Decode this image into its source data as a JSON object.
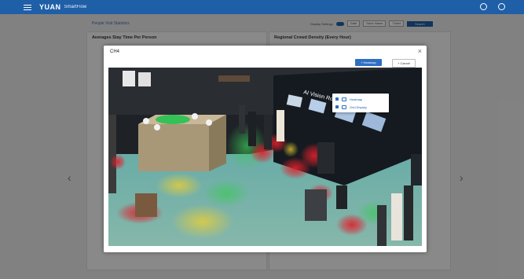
{
  "topbar": {
    "brand": "YUAN",
    "product": "SmartFlow"
  },
  "background_page": {
    "title": "People Visit Statistics",
    "filters": [
      "Display Settings",
      "Date",
      "Store Name",
      "Ticket",
      "Search"
    ],
    "panel_left_title": "Averages Stay Time Per Person",
    "panel_right_title": "Regional Crowd Density (Every Hour)"
  },
  "modal": {
    "title": "CH4",
    "heatmap_button": "+ Heatmap",
    "cancel_button": "+ Cancel",
    "dropdown": [
      {
        "label": "Heatmap"
      },
      {
        "label": "Grid Display"
      }
    ],
    "scene": {
      "booth_sign": "AI Vision Robotics"
    }
  },
  "colors": {
    "topbar": "#1f5fa8",
    "accent": "#2e6fc4",
    "heatmap_red": "#e0202c",
    "heatmap_green": "#3cc85a"
  }
}
